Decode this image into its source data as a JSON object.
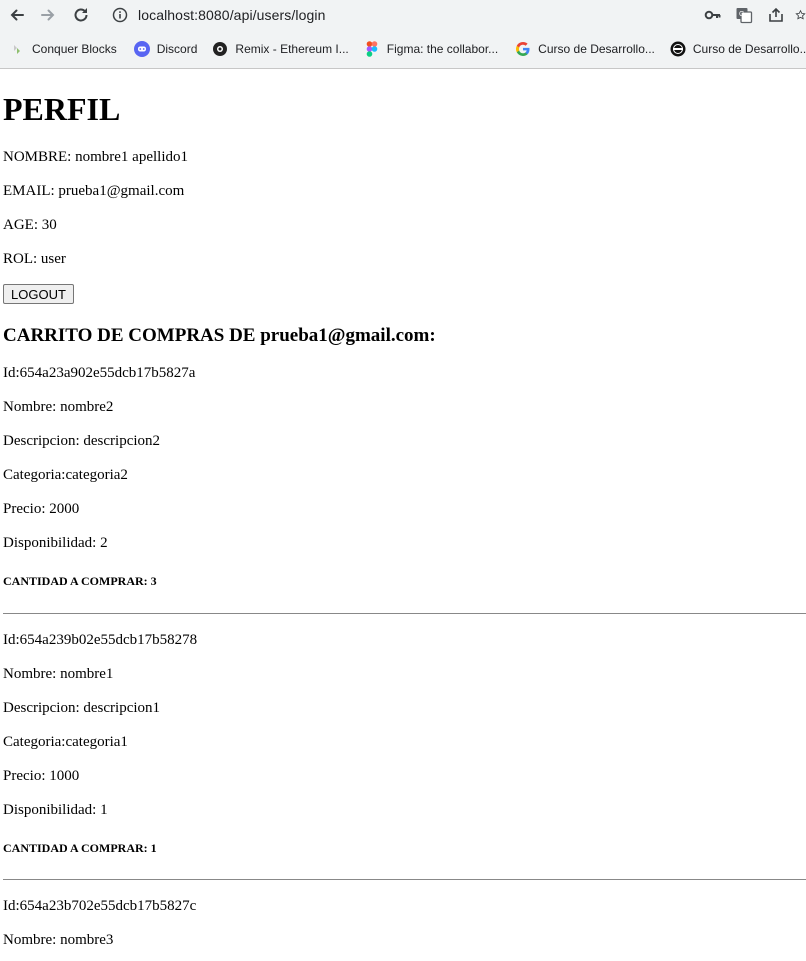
{
  "browser": {
    "url": "localhost:8080/api/users/login",
    "bookmarks": [
      {
        "label": "Conquer Blocks",
        "icon": "conquer-blocks-icon"
      },
      {
        "label": "Discord",
        "icon": "discord-icon"
      },
      {
        "label": "Remix - Ethereum I...",
        "icon": "remix-icon"
      },
      {
        "label": "Figma: the collabor...",
        "icon": "figma-icon"
      },
      {
        "label": "Curso de Desarrollo...",
        "icon": "google-icon"
      },
      {
        "label": "Curso de Desarrollo...",
        "icon": "course-icon"
      }
    ]
  },
  "profile": {
    "title": "PERFIL",
    "name": "NOMBRE: nombre1 apellido1",
    "email": "EMAIL: prueba1@gmail.com",
    "age": "AGE: 30",
    "role": "ROL: user",
    "logout_label": "LOGOUT"
  },
  "cart": {
    "title": "CARRITO DE COMPRAS DE prueba1@gmail.com:",
    "items": [
      {
        "id": "Id:654a23a902e55dcb17b5827a",
        "nombre": "Nombre: nombre2",
        "descripcion": "Descripcion: descripcion2",
        "categoria": "Categoria:categoria2",
        "precio": "Precio: 2000",
        "disponibilidad": "Disponibilidad: 2",
        "cantidad": "CANTIDAD A COMPRAR: 3"
      },
      {
        "id": "Id:654a239b02e55dcb17b58278",
        "nombre": "Nombre: nombre1",
        "descripcion": "Descripcion: descripcion1",
        "categoria": "Categoria:categoria1",
        "precio": "Precio: 1000",
        "disponibilidad": "Disponibilidad: 1",
        "cantidad": "CANTIDAD A COMPRAR: 1"
      },
      {
        "id": "Id:654a23b702e55dcb17b5827c",
        "nombre": "Nombre: nombre3"
      }
    ]
  }
}
